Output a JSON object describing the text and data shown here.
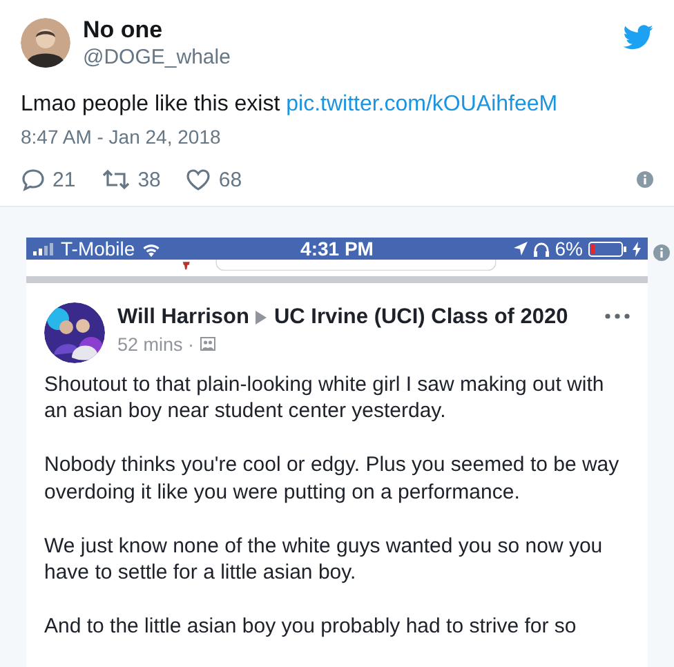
{
  "tweet": {
    "author": {
      "name": "No one",
      "handle": "@DOGE_whale"
    },
    "text": "Lmao people like this exist",
    "link": "pic.twitter.com/kOUAihfeeM",
    "timestamp": "8:47 AM - Jan 24, 2018",
    "actions": [
      {
        "kind": "reply",
        "count": "21"
      },
      {
        "kind": "retweet",
        "count": "38"
      },
      {
        "kind": "like",
        "count": "68"
      }
    ]
  },
  "screenshot": {
    "status_bar": {
      "carrier": "T-Mobile",
      "time": "4:31 PM",
      "battery": "6%"
    },
    "post": {
      "author": "Will Harrison",
      "group": "UC Irvine (UCI) Class of 2020",
      "time": "52 mins ·",
      "paragraphs": [
        "Shoutout to that plain-looking white girl I saw making out with an asian boy near student center yesterday.",
        "Nobody thinks you're cool or edgy. Plus you seemed to be way overdoing it like you were putting on a performance.",
        "We just know none of the white guys wanted you so now you have to settle for a little asian boy.",
        "And to the little asian boy you probably had to strive for so"
      ]
    }
  }
}
